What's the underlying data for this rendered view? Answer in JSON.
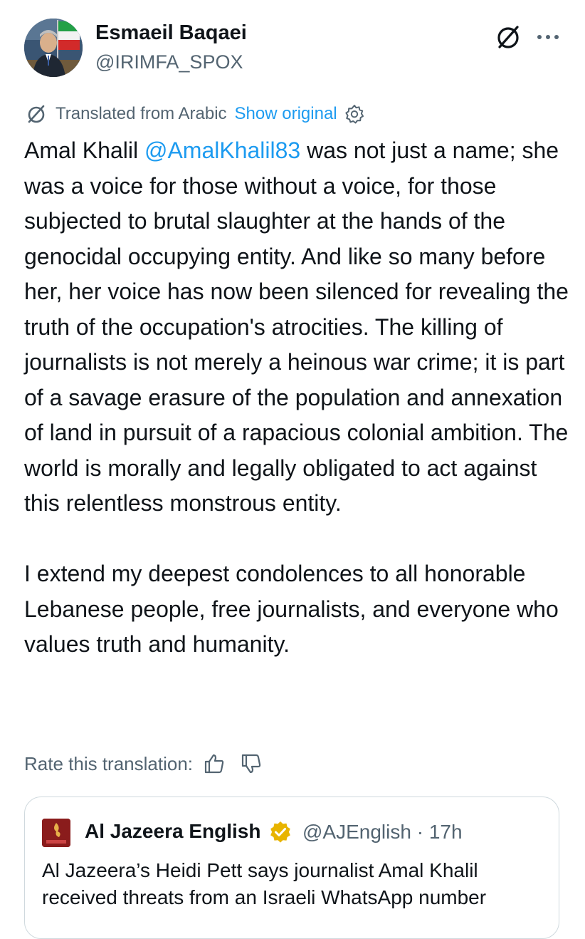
{
  "author": {
    "name": "Esmaeil Baqaei",
    "handle": "@IRIMFA_SPOX",
    "avatar_icon": "profile-photo"
  },
  "actions": {
    "grok_icon": "grok-icon",
    "more_icon": "more-horizontal-icon"
  },
  "translation": {
    "label": "Translated from Arabic",
    "show_original": "Show original",
    "settings_icon": "gear-icon"
  },
  "tweet": {
    "part1_before": "Amal Khalil ",
    "mention": "@AmalKhalil83",
    "part1_after": " was not just a name; she was a voice for those without a voice, for those subjected to brutal slaughter at the hands of the genocidal occupying entity. And like so many before her, her voice has now been silenced for revealing the truth of the occupation's atrocities. The killing of journalists is not merely a heinous war crime; it is part of a savage erasure of the population and annexation of land in pursuit of a rapacious colonial ambition. The world is morally and legally obligated to act against this relentless monstrous entity.",
    "paragraph2": "I extend my deepest condolences to all honorable Lebanese people, free journalists, and everyone who values truth and humanity."
  },
  "rating": {
    "label": "Rate this translation:",
    "thumbs_up_icon": "thumbs-up-icon",
    "thumbs_down_icon": "thumbs-down-icon"
  },
  "quoted_tweet": {
    "name": "Al Jazeera English",
    "handle_time": "@AJEnglish · 17h",
    "verified_color": "#e8b400",
    "text": "Al Jazeera’s Heidi Pett says journalist Amal Khalil received threats from an Israeli WhatsApp number",
    "avatar_logo_text": "ALJAZEERA"
  },
  "colors": {
    "accent": "#1d9bf0",
    "secondary_text": "#536471",
    "primary_text": "#0f1419",
    "border": "#cfd9de"
  }
}
